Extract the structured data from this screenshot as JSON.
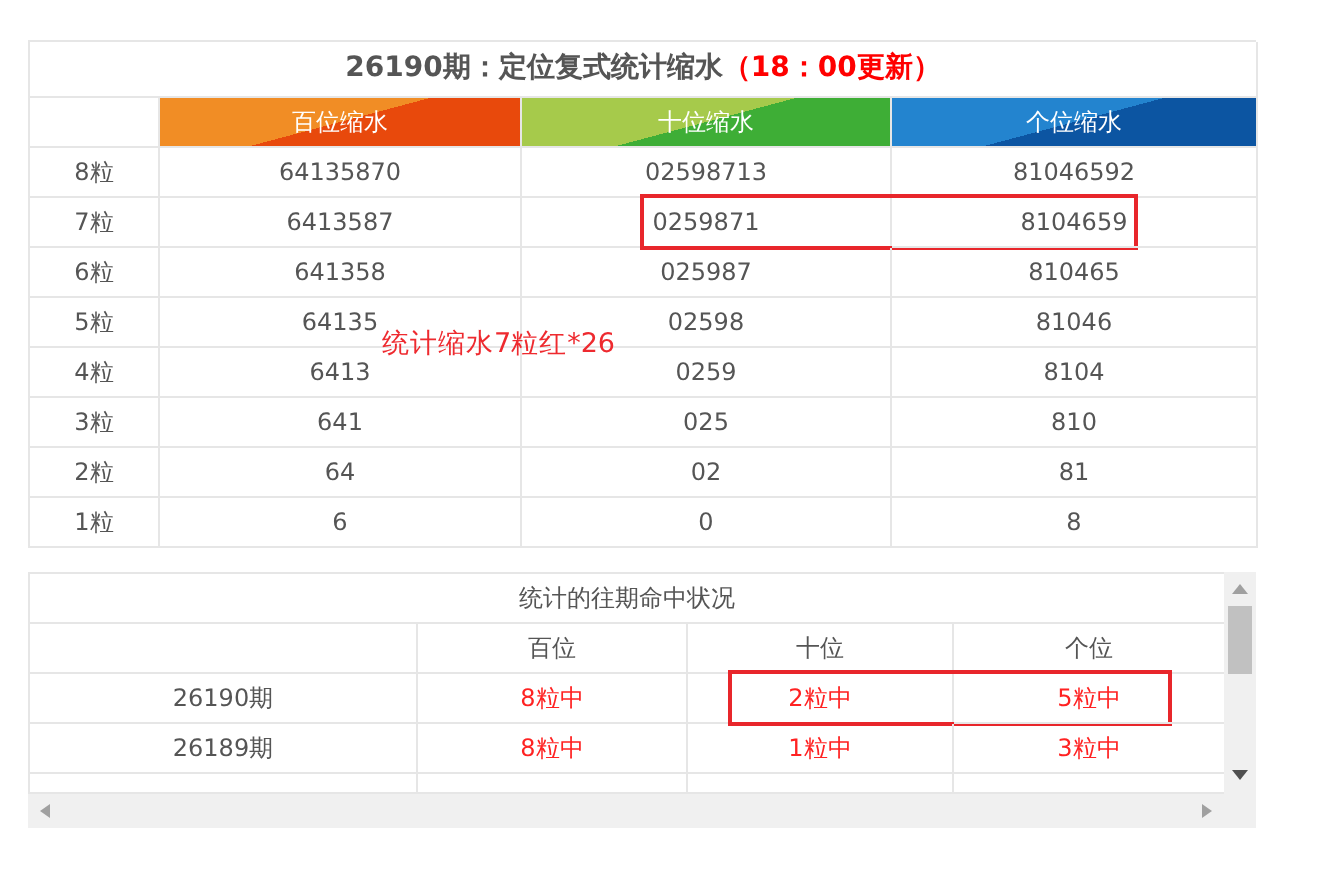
{
  "stats_table": {
    "title": "26190期：定位复式统计缩水",
    "update_note": "（18：00更新）",
    "columns": [
      {
        "label": "百位缩水",
        "kind": "orange"
      },
      {
        "label": "十位缩水",
        "kind": "green"
      },
      {
        "label": "个位缩水",
        "kind": "blue"
      }
    ],
    "rows": [
      {
        "label": "8粒",
        "values": [
          "64135870",
          "02598713",
          "81046592"
        ],
        "boxed": false
      },
      {
        "label": "7粒",
        "values": [
          "6413587",
          "0259871",
          "8104659"
        ],
        "boxed": true
      },
      {
        "label": "6粒",
        "values": [
          "641358",
          "025987",
          "810465"
        ],
        "boxed": false
      },
      {
        "label": "5粒",
        "values": [
          "64135",
          "02598",
          "81046"
        ],
        "boxed": false
      },
      {
        "label": "4粒",
        "values": [
          "6413",
          "0259",
          "8104"
        ],
        "boxed": false
      },
      {
        "label": "3粒",
        "values": [
          "641",
          "025",
          "810"
        ],
        "boxed": false
      },
      {
        "label": "2粒",
        "values": [
          "64",
          "02",
          "81"
        ],
        "boxed": false
      },
      {
        "label": "1粒",
        "values": [
          "6",
          "0",
          "8"
        ],
        "boxed": false
      }
    ]
  },
  "overlay_note": "统计缩水7粒红*26",
  "history_table": {
    "title": "统计的往期命中状况",
    "columns": [
      "百位",
      "十位",
      "个位"
    ],
    "rows": [
      {
        "period": "26190期",
        "hits": [
          "8粒中",
          "2粒中",
          "5粒中"
        ],
        "boxed": true
      },
      {
        "period": "26189期",
        "hits": [
          "8粒中",
          "1粒中",
          "3粒中"
        ],
        "boxed": false
      }
    ]
  }
}
